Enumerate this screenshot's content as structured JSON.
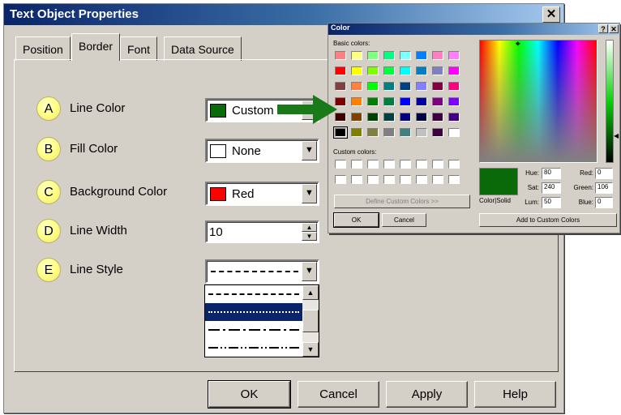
{
  "main": {
    "title": "Text Object Properties",
    "close_glyph": "✕",
    "tabs": [
      {
        "label": "Position"
      },
      {
        "label": "Border"
      },
      {
        "label": "Font"
      },
      {
        "label": "Data Source"
      }
    ],
    "active_tab": "Border",
    "rows": [
      {
        "badge": "A",
        "label": "Line Color",
        "value": "Custom",
        "swatch": "#0a6a0a"
      },
      {
        "badge": "B",
        "label": "Fill Color",
        "value": "None",
        "swatch": "#ffffff"
      },
      {
        "badge": "C",
        "label": "Background Color",
        "value": "Red",
        "swatch": "#ff0000"
      },
      {
        "badge": "D",
        "label": "Line Width",
        "value": "10"
      },
      {
        "badge": "E",
        "label": "Line Style"
      }
    ],
    "buttons": {
      "ok": "OK",
      "cancel": "Cancel",
      "apply": "Apply",
      "help": "Help"
    },
    "arrow_color": "#1a7a1a"
  },
  "color_dialog": {
    "title": "Color",
    "help_glyph": "?",
    "close_glyph": "✕",
    "basic_colors_label": "Basic colors:",
    "custom_colors_label": "Custom colors:",
    "define_button": "Define Custom Colors >>",
    "ok": "OK",
    "cancel": "Cancel",
    "add_button": "Add to Custom Colors",
    "color_solid_label": "Color|Solid",
    "preview_color": "#0a6a0a",
    "hue_label": "Hue:",
    "hue": "80",
    "sat_label": "Sat:",
    "sat": "240",
    "lum_label": "Lum:",
    "lum": "50",
    "red_label": "Red:",
    "red": "0",
    "green_label": "Green:",
    "green": "106",
    "blue_label": "Blue:",
    "blue": "0",
    "basic_colors": [
      "#ff8080",
      "#ffff80",
      "#80ff80",
      "#00ff80",
      "#80ffff",
      "#0080ff",
      "#ff80c0",
      "#ff80ff",
      "#ff0000",
      "#ffff00",
      "#80ff00",
      "#00ff40",
      "#00ffff",
      "#0080c0",
      "#8080c0",
      "#ff00ff",
      "#804040",
      "#ff8040",
      "#00ff00",
      "#008080",
      "#004080",
      "#8080ff",
      "#800040",
      "#ff0080",
      "#800000",
      "#ff8000",
      "#008000",
      "#008040",
      "#0000ff",
      "#0000a0",
      "#800080",
      "#8000ff",
      "#400000",
      "#804000",
      "#004000",
      "#004040",
      "#000080",
      "#000040",
      "#400040",
      "#400080",
      "#000000",
      "#808000",
      "#808040",
      "#808080",
      "#408080",
      "#c0c0c0",
      "#400040",
      "#ffffff"
    ]
  }
}
